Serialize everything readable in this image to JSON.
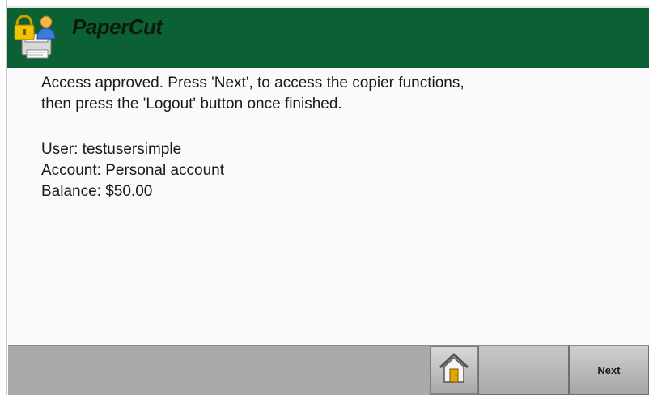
{
  "header": {
    "brand": "PaperCut",
    "logo_icon": "papercut-logo-icon"
  },
  "main": {
    "message_line1": "Access approved. Press 'Next', to access the copier functions,",
    "message_line2": "then press the 'Logout' button once finished.",
    "user_line": "User: testusersimple",
    "account_line": "Account: Personal account",
    "balance_line": "Balance: $50.00"
  },
  "footer": {
    "home_icon": "home-icon",
    "next_label": "Next"
  },
  "colors": {
    "header_bg": "#0b6133",
    "footer_bg": "#a9a9a9",
    "content_bg": "#fafafa"
  }
}
